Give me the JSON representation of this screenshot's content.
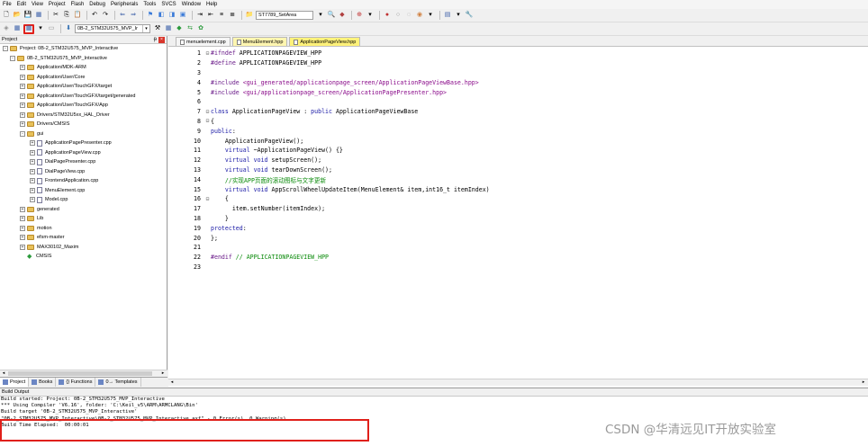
{
  "menubar": [
    "File",
    "Edit",
    "View",
    "Project",
    "Flash",
    "Debug",
    "Peripherals",
    "Tools",
    "SVCS",
    "Window",
    "Help"
  ],
  "toolbar": {
    "target_combo": "ST7789_SetArea",
    "project_combo": "0B-2_STM32U575_MVP_Ir"
  },
  "project_pane": {
    "title": "Project",
    "root": "Project: 0B-2_STM32U575_MVP_Interactive",
    "target": "0B-2_STM32U575_MVP_Interactive",
    "groups": [
      "Application/MDK-ARM",
      "Application/User/Core",
      "Application/User/TouchGFX/target",
      "Application/User/TouchGFX/target/generated",
      "Application/User/TouchGFX/App",
      "Drivers/STM32U5xx_HAL_Driver",
      "Drivers/CMSIS"
    ],
    "gui_group": "gui",
    "gui_files": [
      "ApplicationPagePresenter.cpp",
      "ApplicationPageView.cpp",
      "DialPagePresenter.cpp",
      "DialPageView.cpp",
      "FrontendApplication.cpp",
      "MenuElement.cpp",
      "Model.cpp"
    ],
    "more_groups": [
      "generated",
      "Lib",
      "motion",
      "efsm-master",
      "MAX30102_Maxim"
    ],
    "cmsis": "CMSIS",
    "tabs": [
      "Project",
      "Books",
      "{} Functions",
      "0→ Templates"
    ]
  },
  "editor": {
    "tabs": [
      "menuelement.cpp",
      "MenuElement.hpp",
      "ApplicationPageView.hpp"
    ],
    "lines": [
      {
        "n": "1",
        "fold": "⊟",
        "parts": [
          [
            "pp",
            "#ifndef "
          ],
          [
            "txt",
            "APPLICATIONPAGEVIEW_HPP"
          ]
        ]
      },
      {
        "n": "2",
        "fold": "",
        "parts": [
          [
            "pp",
            "#define "
          ],
          [
            "txt",
            "APPLICATIONPAGEVIEW_HPP"
          ]
        ]
      },
      {
        "n": "3",
        "fold": "",
        "parts": []
      },
      {
        "n": "4",
        "fold": "",
        "parts": [
          [
            "pp",
            "#include "
          ],
          [
            "str",
            "<gui_generated/applicationpage_screen/ApplicationPageViewBase.hpp>"
          ]
        ]
      },
      {
        "n": "5",
        "fold": "",
        "parts": [
          [
            "pp",
            "#include "
          ],
          [
            "str",
            "<gui/applicationpage_screen/ApplicationPagePresenter.hpp>"
          ]
        ]
      },
      {
        "n": "6",
        "fold": "",
        "parts": []
      },
      {
        "n": "7",
        "fold": "⊟",
        "parts": [
          [
            "kw",
            "class "
          ],
          [
            "txt",
            "ApplicationPageView : "
          ],
          [
            "kw",
            "public "
          ],
          [
            "txt",
            "ApplicationPageViewBase"
          ]
        ]
      },
      {
        "n": "8",
        "fold": "⊟",
        "parts": [
          [
            "txt",
            "{"
          ]
        ]
      },
      {
        "n": "9",
        "fold": "",
        "parts": [
          [
            "kw",
            "public"
          ],
          [
            "txt",
            ":"
          ]
        ]
      },
      {
        "n": "10",
        "fold": "",
        "parts": [
          [
            "txt",
            "    ApplicationPageView();"
          ]
        ]
      },
      {
        "n": "11",
        "fold": "",
        "parts": [
          [
            "kw",
            "    virtual "
          ],
          [
            "txt",
            "~ApplicationPageView() {}"
          ]
        ]
      },
      {
        "n": "12",
        "fold": "",
        "parts": [
          [
            "kw",
            "    virtual void "
          ],
          [
            "txt",
            "setupScreen();"
          ]
        ]
      },
      {
        "n": "13",
        "fold": "",
        "parts": [
          [
            "kw",
            "    virtual void "
          ],
          [
            "txt",
            "tearDownScreen();"
          ]
        ]
      },
      {
        "n": "14",
        "fold": "",
        "parts": [
          [
            "cm",
            "    //实现APP页面的滚动图标与文字更新"
          ]
        ]
      },
      {
        "n": "15",
        "fold": "",
        "parts": [
          [
            "kw",
            "    virtual void "
          ],
          [
            "txt",
            "AppScrollWheelUpdateItem(MenuElement& item,int16_t itemIndex)"
          ]
        ]
      },
      {
        "n": "16",
        "fold": "⊟",
        "parts": [
          [
            "txt",
            "    {"
          ]
        ]
      },
      {
        "n": "17",
        "fold": "",
        "parts": [
          [
            "txt",
            "      item.setNumber(itemIndex);"
          ]
        ]
      },
      {
        "n": "18",
        "fold": "",
        "parts": [
          [
            "txt",
            "    }"
          ]
        ]
      },
      {
        "n": "19",
        "fold": "",
        "parts": [
          [
            "kw",
            "protected"
          ],
          [
            "txt",
            ":"
          ]
        ]
      },
      {
        "n": "20",
        "fold": "",
        "parts": [
          [
            "txt",
            "};"
          ]
        ]
      },
      {
        "n": "21",
        "fold": "",
        "parts": []
      },
      {
        "n": "22",
        "fold": "",
        "parts": [
          [
            "pp",
            "#endif "
          ],
          [
            "cm",
            "// APPLICATIONPAGEVIEW_HPP"
          ]
        ]
      },
      {
        "n": "23",
        "fold": "",
        "parts": []
      }
    ]
  },
  "build_output": {
    "title": "Build Output",
    "lines": [
      "Build started: Project: 0B-2_STM32U575_MVP_Interactive",
      "*** Using Compiler 'V6.16', folder: 'C:\\Keil_v5\\ARM\\ARMCLANG\\Bin'",
      "Build target '0B-2_STM32U575_MVP_Interactive'",
      "\"0B-2_STM32U575_MVP_Interactive\\0B-2_STM32U575_MVP_Interactive.axf\" - 0 Error(s), 0 Warning(s).",
      "Build Time Elapsed:  00:00:01"
    ]
  },
  "watermark": "CSDN @华清远见IT开放实验室"
}
